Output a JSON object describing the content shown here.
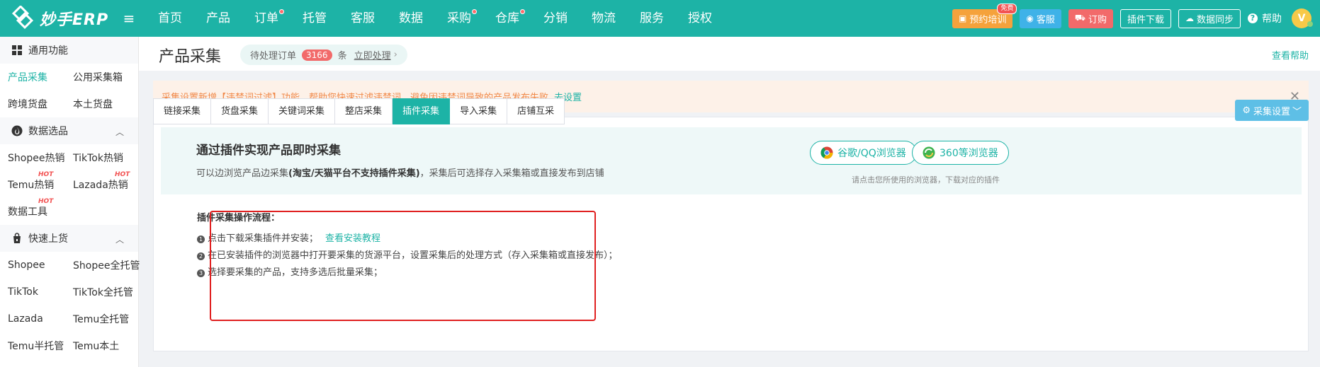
{
  "brand": {
    "name": "妙手ERP"
  },
  "nav": {
    "items": [
      {
        "label": "首页",
        "dot": false
      },
      {
        "label": "产品",
        "dot": false
      },
      {
        "label": "订单",
        "dot": true
      },
      {
        "label": "托管",
        "dot": false
      },
      {
        "label": "客服",
        "dot": false
      },
      {
        "label": "数据",
        "dot": false
      },
      {
        "label": "采购",
        "dot": true
      },
      {
        "label": "仓库",
        "dot": true
      },
      {
        "label": "分销",
        "dot": false
      },
      {
        "label": "物流",
        "dot": false
      },
      {
        "label": "服务",
        "dot": false
      },
      {
        "label": "授权",
        "dot": false
      }
    ]
  },
  "header": {
    "training_label": "预约培训",
    "training_badge": "免费",
    "service_label": "客服",
    "subscribe_label": "订购",
    "plugin_download_label": "插件下载",
    "data_sync_label": "数据同步",
    "help_label": "帮助",
    "avatar_letter": "V"
  },
  "sidebar": {
    "sections": [
      {
        "title": "通用功能",
        "collapsible": false,
        "rows": [
          [
            {
              "label": "产品采集",
              "active": true
            },
            {
              "label": "公用采集箱"
            }
          ],
          [
            {
              "label": "跨境货盘"
            },
            {
              "label": "本土货盘"
            }
          ]
        ]
      },
      {
        "title": "数据选品",
        "collapsible": true,
        "rows": [
          [
            {
              "label": "Shopee热销"
            },
            {
              "label": "TikTok热销"
            }
          ],
          [
            {
              "label": "Temu热销",
              "hot": "HOT"
            },
            {
              "label": "Lazada热销",
              "hot": "HOT"
            }
          ],
          [
            {
              "label": "数据工具",
              "hot": "HOT"
            }
          ]
        ]
      },
      {
        "title": "快速上货",
        "collapsible": true,
        "rows": [
          [
            {
              "label": "Shopee"
            },
            {
              "label": "Shopee全托管"
            }
          ],
          [
            {
              "label": "TikTok"
            },
            {
              "label": "TikTok全托管"
            }
          ],
          [
            {
              "label": "Lazada"
            },
            {
              "label": "Temu全托管"
            }
          ],
          [
            {
              "label": "Temu半托管"
            },
            {
              "label": "Temu本土"
            }
          ]
        ]
      }
    ]
  },
  "page": {
    "title": "产品采集",
    "pending": {
      "prefix": "待处理订单",
      "count": "3166",
      "unit": "条",
      "action": "立即处理"
    },
    "help_link": "查看帮助"
  },
  "notice": {
    "text": "采集设置新增【违禁词过滤】功能，帮助您快速过滤违禁词，避免因违禁词导致的产品发布失败",
    "link": "去设置"
  },
  "tabs": [
    {
      "label": "链接采集",
      "active": false
    },
    {
      "label": "货盘采集",
      "active": false
    },
    {
      "label": "关键词采集",
      "active": false
    },
    {
      "label": "整店采集",
      "active": false
    },
    {
      "label": "插件采集",
      "active": true
    },
    {
      "label": "导入采集",
      "active": false
    },
    {
      "label": "店铺互采",
      "active": false
    }
  ],
  "settings_button": {
    "label": "采集设置"
  },
  "banner": {
    "title": "通过插件实现产品即时采集",
    "sub_prefix": "可以边浏览产品边采集",
    "sub_bold": "(淘宝/天猫平台不支持插件采集)",
    "sub_suffix": "，采集后可选择存入采集箱或直接发布到店铺",
    "browsers": [
      {
        "label": "谷歌/QQ浏览器",
        "icon": "chrome-icon"
      },
      {
        "label": "360等浏览器",
        "icon": "360-browser-icon"
      }
    ],
    "hint": "请点击您所使用的浏览器，下载对应的插件"
  },
  "flow": {
    "title": "插件采集操作流程：",
    "steps": [
      {
        "num": "1",
        "text": "点击下载采集插件并安装；",
        "link": "查看安装教程"
      },
      {
        "num": "2",
        "text": "在已安装插件的浏览器中打开要采集的货源平台，设置采集后的处理方式（存入采集箱或直接发布）；"
      },
      {
        "num": "3",
        "text": "选择要采集的产品，支持多选后批量采集；"
      }
    ]
  },
  "colors": {
    "brand": "#1db3a6",
    "annotation": "#e02020",
    "notice_bg": "#fdf1e8",
    "notice_text": "#f08a4b"
  }
}
